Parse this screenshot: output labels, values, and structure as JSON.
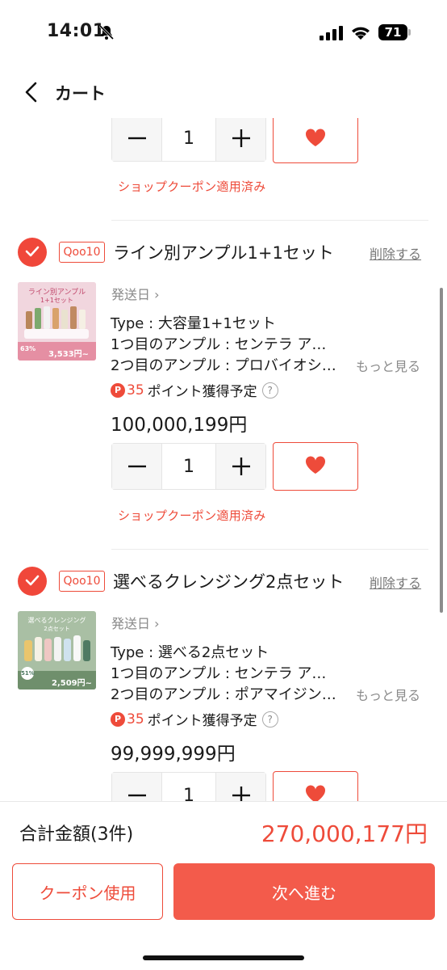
{
  "status": {
    "time": "14:01",
    "battery": "71"
  },
  "nav": {
    "title": "カート"
  },
  "top_partial": {
    "quantity": "1",
    "coupon_note": "ショップクーポン適用済み"
  },
  "items": [
    {
      "badge": "Qoo10",
      "title": "ライン別アンプル1+1セット",
      "delete": "削除する",
      "ship": "発送日",
      "thumb": {
        "headline": "ライン別アンプル",
        "sub": "1+1セット",
        "discount": "63%",
        "price": "3,533円~"
      },
      "options": [
        "Type : 大容量1+1セット",
        "1つ目のアンプル : センテラ ア…",
        "2つ目のアンプル : プロバイオシ…"
      ],
      "more": "もっと見る",
      "points_num": "35",
      "points_text": "ポイント獲得予定",
      "price": "100,000,199円",
      "quantity": "1",
      "coupon_note": "ショップクーポン適用済み"
    },
    {
      "badge": "Qoo10",
      "title": "選べるクレンジング2点セット",
      "delete": "削除する",
      "ship": "発送日",
      "thumb": {
        "headline": "選べるクレンジング",
        "sub": "2点セット",
        "discount": "51%",
        "price": "2,509円~"
      },
      "options": [
        "Type : 選べる2点セット",
        "1つ目のアンプル : センテラ ア…",
        "2つ目のアンプル : ポアマイジン…"
      ],
      "more": "もっと見る",
      "points_num": "35",
      "points_text": "ポイント獲得予定",
      "price": "99,999,999円",
      "quantity": "1"
    }
  ],
  "footer": {
    "total_label": "合計金額(3件)",
    "total_value": "270,000,177円",
    "coupon_button": "クーポン使用",
    "next_button": "次へ進む"
  },
  "colors": {
    "accent": "#ee4b3a",
    "next_button": "#f35b4b"
  }
}
